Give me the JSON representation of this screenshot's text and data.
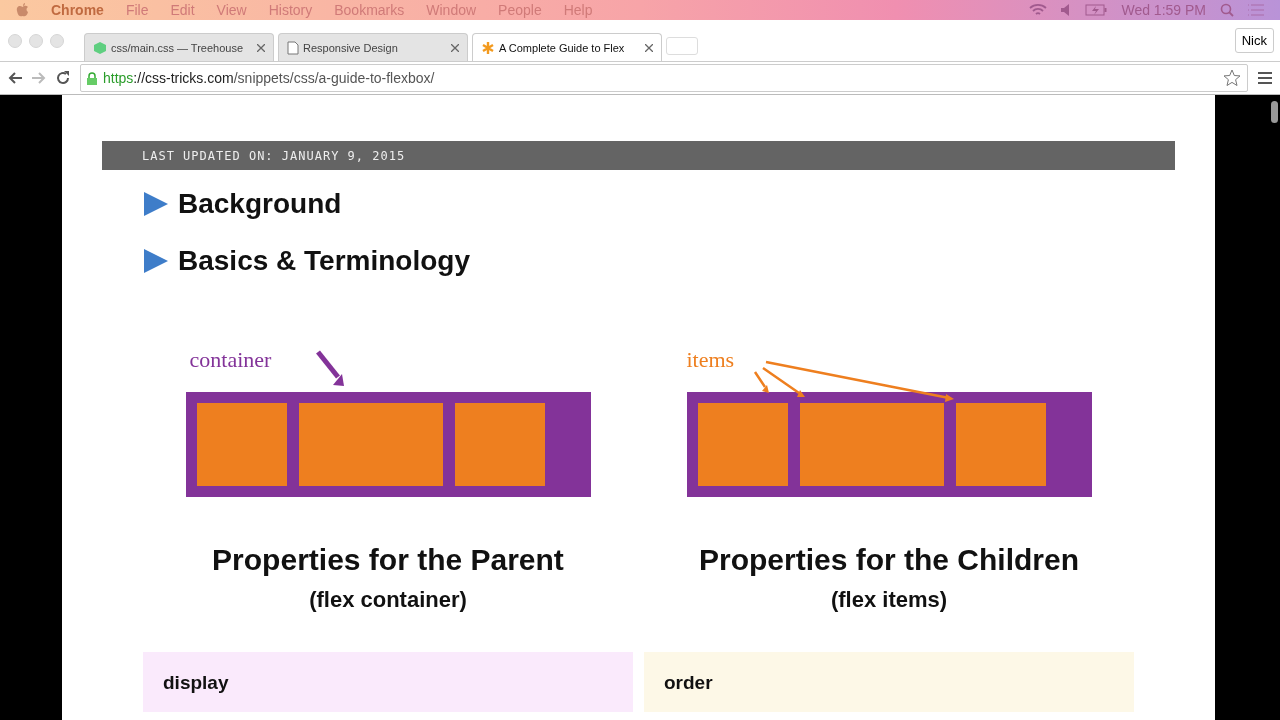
{
  "menu_bar": {
    "app": "Chrome",
    "items": [
      "File",
      "Edit",
      "View",
      "History",
      "Bookmarks",
      "Window",
      "People",
      "Help"
    ],
    "clock": "Wed 1:59 PM"
  },
  "tabs": [
    {
      "title": "css/main.css — Treehouse",
      "kind": "treehouse",
      "selected": false
    },
    {
      "title": "Responsive Design",
      "kind": "page",
      "selected": false
    },
    {
      "title": "A Complete Guide to Flex",
      "kind": "star",
      "selected": true
    }
  ],
  "profile": "Nick",
  "address": {
    "scheme": "https",
    "host": "://css-tricks.com",
    "path": "/snippets/css/a-guide-to-flexbox/"
  },
  "article": {
    "updated": "LAST UPDATED ON: JANUARY 9, 2015",
    "sections": [
      {
        "title": "Background",
        "expanded": false
      },
      {
        "title": "Basics & Terminology",
        "expanded": false
      }
    ],
    "columns": [
      {
        "kind": "container",
        "label": "container",
        "heading": "Properties for the Parent",
        "subheading": "(flex container)",
        "card_title": "display"
      },
      {
        "kind": "items",
        "label": "items",
        "heading": "Properties for the Children",
        "subheading": "(flex items)",
        "card_title": "order"
      }
    ]
  }
}
